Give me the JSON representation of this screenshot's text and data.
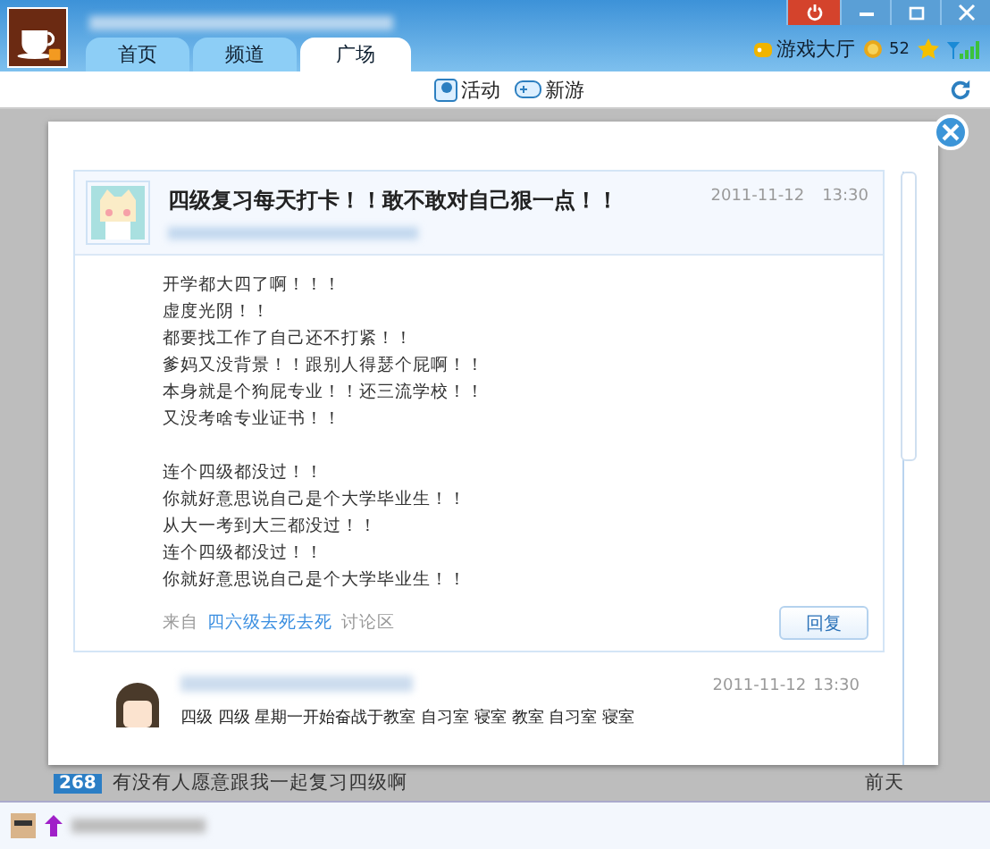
{
  "tabs": [
    {
      "label": "首页",
      "selected": false
    },
    {
      "label": "频道",
      "selected": false
    },
    {
      "label": "广场",
      "selected": true
    }
  ],
  "header": {
    "game_hall": "游戏大厅",
    "coins": "52"
  },
  "toolbar": {
    "items": [
      {
        "label": "活动",
        "kind": "activity"
      },
      {
        "label": "新游",
        "kind": "gamepad"
      }
    ]
  },
  "post": {
    "title": "四级复习每天打卡！！敢不敢对自己狠一点！！",
    "date": "2011-11-12",
    "time": "13:30",
    "paragraphs": [
      [
        "开学都大四了啊！！！",
        "虚度光阴！！",
        "都要找工作了自己还不打紧！！",
        "爹妈又没背景！！跟别人得瑟个屁啊！！",
        "本身就是个狗屁专业！！还三流学校！！",
        "又没考啥专业证书！！"
      ],
      [
        "连个四级都没过！！",
        "你就好意思说自己是个大学毕业生！！",
        "从大一考到大三都没过！！",
        "连个四级都没过！！",
        "你就好意思说自己是个大学毕业生！！"
      ]
    ],
    "source_prefix": "来自",
    "source_link": "四六级去死去死",
    "source_suffix": "讨论区",
    "reply": "回复"
  },
  "reply_post": {
    "date": "2011-11-12",
    "time": "13:30",
    "text": "四级 四级 星期一开始奋战于教室 自习室 寝室 教室 自习室 寝室"
  },
  "thread": {
    "count": "268",
    "title": "有没有人愿意跟我一起复习四级啊",
    "when": "前天"
  }
}
